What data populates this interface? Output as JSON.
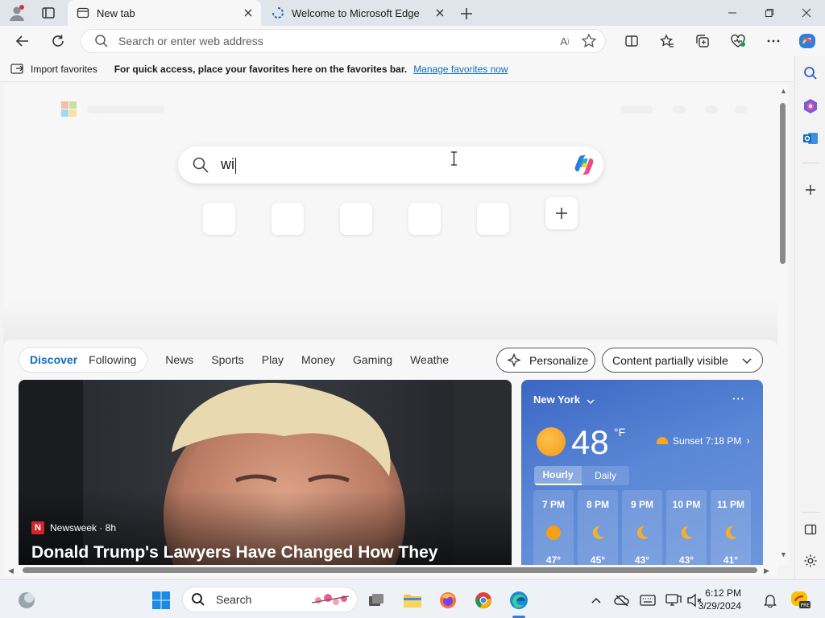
{
  "browser": {
    "tabs": [
      {
        "title": "New tab",
        "active": true
      },
      {
        "title": "Welcome to Microsoft Edge",
        "active": false
      }
    ],
    "address_placeholder": "Search or enter web address",
    "read_aloud_glyph": "A",
    "favorites_bar": {
      "import_label": "Import favorites",
      "message": "For quick access, place your favorites here on the favorites bar.",
      "manage_link": "Manage favorites now"
    }
  },
  "newtab": {
    "search_value": "wi",
    "feed_tabs": [
      {
        "label": "Discover",
        "selected": true
      },
      {
        "label": "Following",
        "selected": false
      }
    ],
    "feed_nav": [
      "News",
      "Sports",
      "Play",
      "Money",
      "Gaming",
      "Weathe"
    ],
    "personalize_label": "Personalize",
    "visibility_label": "Content partially visible",
    "news": {
      "source": "Newsweek · 8h",
      "source_logo": "N",
      "headline": "Donald Trump's Lawyers Have Changed How They"
    },
    "weather": {
      "location": "New York",
      "more": "···",
      "temp": "48",
      "unit": "°F",
      "sunset": "Sunset 7:18 PM",
      "tabs": [
        "Hourly",
        "Daily"
      ],
      "hours": [
        {
          "time": "7 PM",
          "icon": "sun",
          "temp": "47°"
        },
        {
          "time": "8 PM",
          "icon": "moon",
          "temp": "45°"
        },
        {
          "time": "9 PM",
          "icon": "moon",
          "temp": "43°"
        },
        {
          "time": "10 PM",
          "icon": "moon",
          "temp": "43°"
        },
        {
          "time": "11 PM",
          "icon": "moon",
          "temp": "41°"
        }
      ]
    }
  },
  "taskbar": {
    "search_label": "Search",
    "time": "6:12 PM",
    "date": "3/29/2024"
  },
  "colors": {
    "accent": "#0f6cbd",
    "weather_bg": "#4a76cf"
  }
}
